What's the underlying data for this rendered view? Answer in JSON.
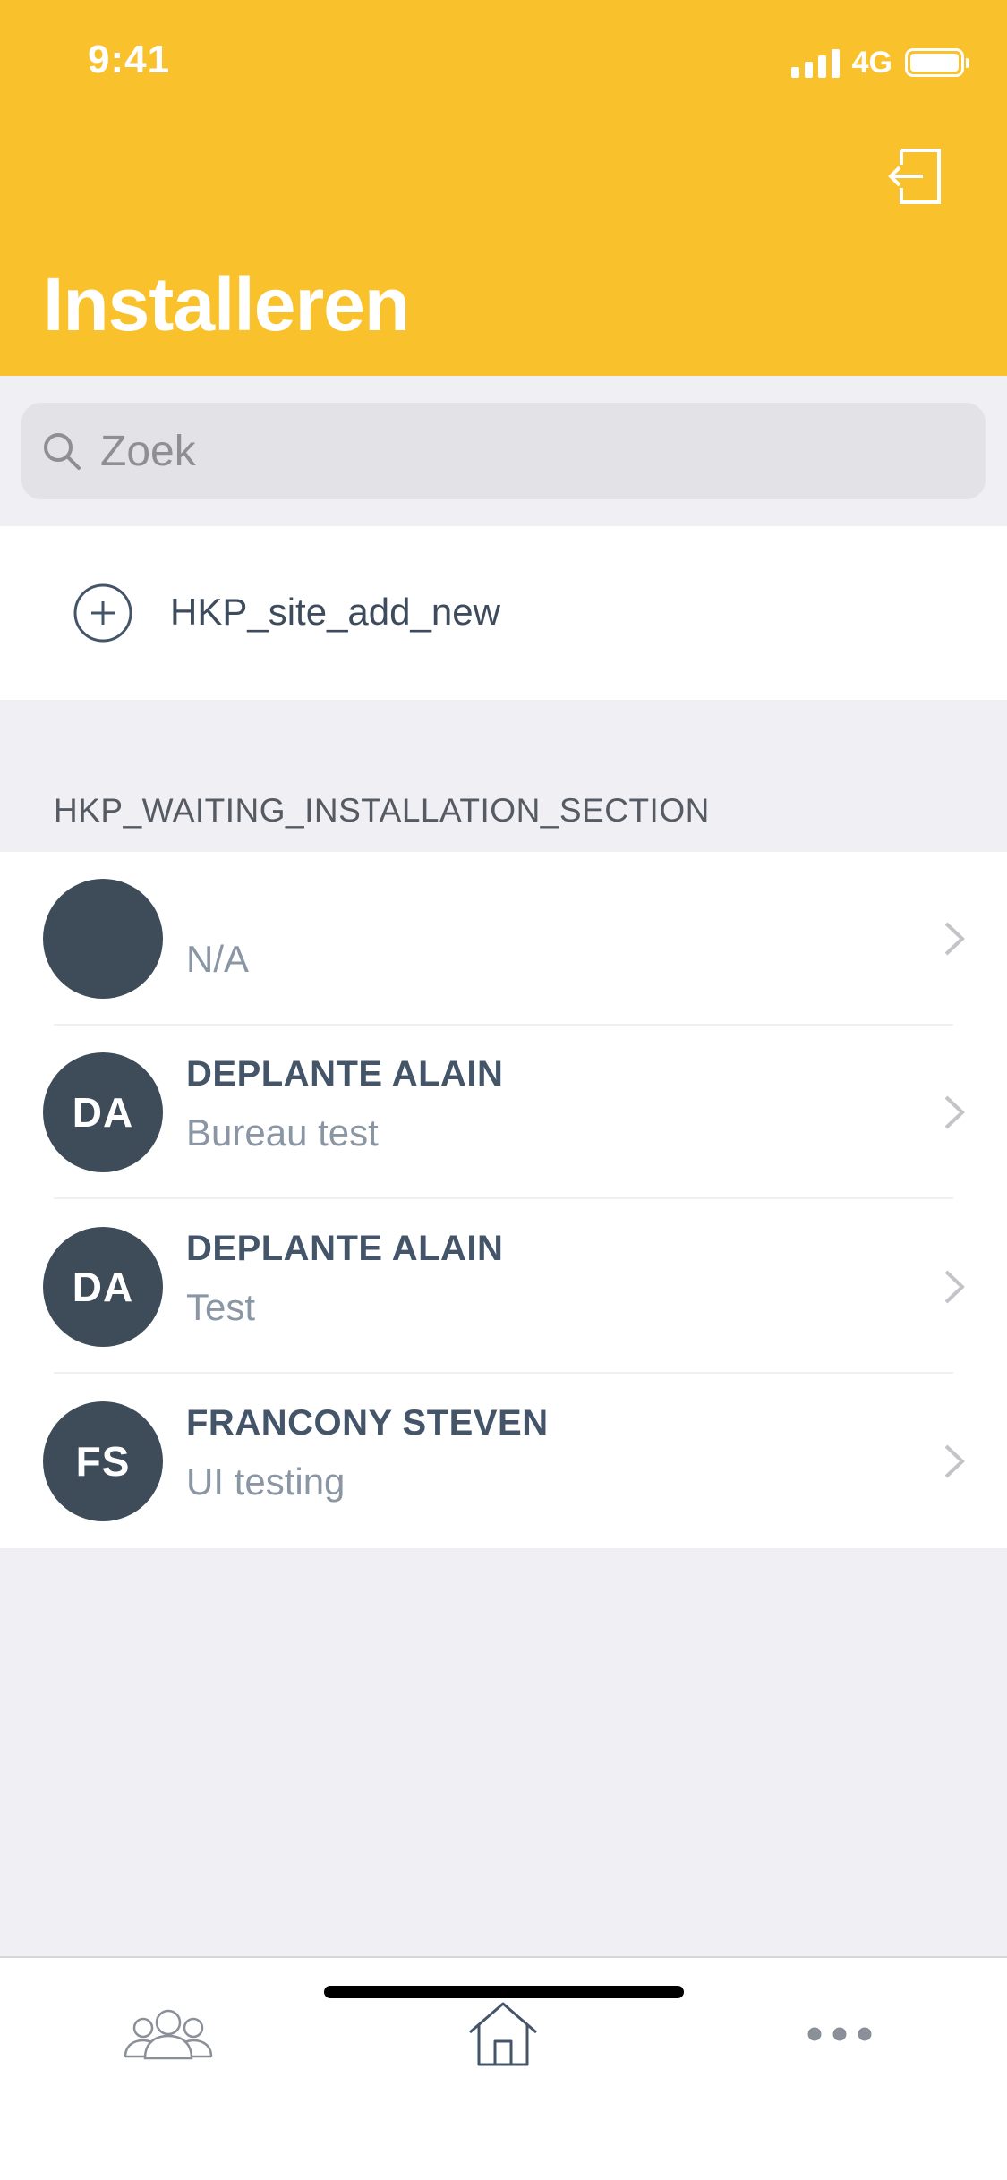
{
  "status_bar": {
    "time": "9:41",
    "network": "4G"
  },
  "header": {
    "title": "Installeren",
    "logout_icon": "logout-icon"
  },
  "search": {
    "placeholder": "Zoek"
  },
  "add_new": {
    "label": "HKP_site_add_new",
    "icon": "plus-circle-icon"
  },
  "section": {
    "title": "HKP_WAITING_INSTALLATION_SECTION"
  },
  "list": [
    {
      "initials": "",
      "name": "",
      "subtitle": "N/A"
    },
    {
      "initials": "DA",
      "name": "DEPLANTE ALAIN",
      "subtitle": "Bureau test"
    },
    {
      "initials": "DA",
      "name": "DEPLANTE ALAIN",
      "subtitle": "Test"
    },
    {
      "initials": "FS",
      "name": "FRANCONY STEVEN",
      "subtitle": "UI testing"
    }
  ],
  "tabbar": {
    "tabs": [
      "users-icon",
      "home-icon",
      "more-icon"
    ]
  },
  "colors": {
    "header": "#f9c12b",
    "avatar": "#3e4c5a",
    "text_dark": "#44556a",
    "text_light": "#8a96a4"
  }
}
